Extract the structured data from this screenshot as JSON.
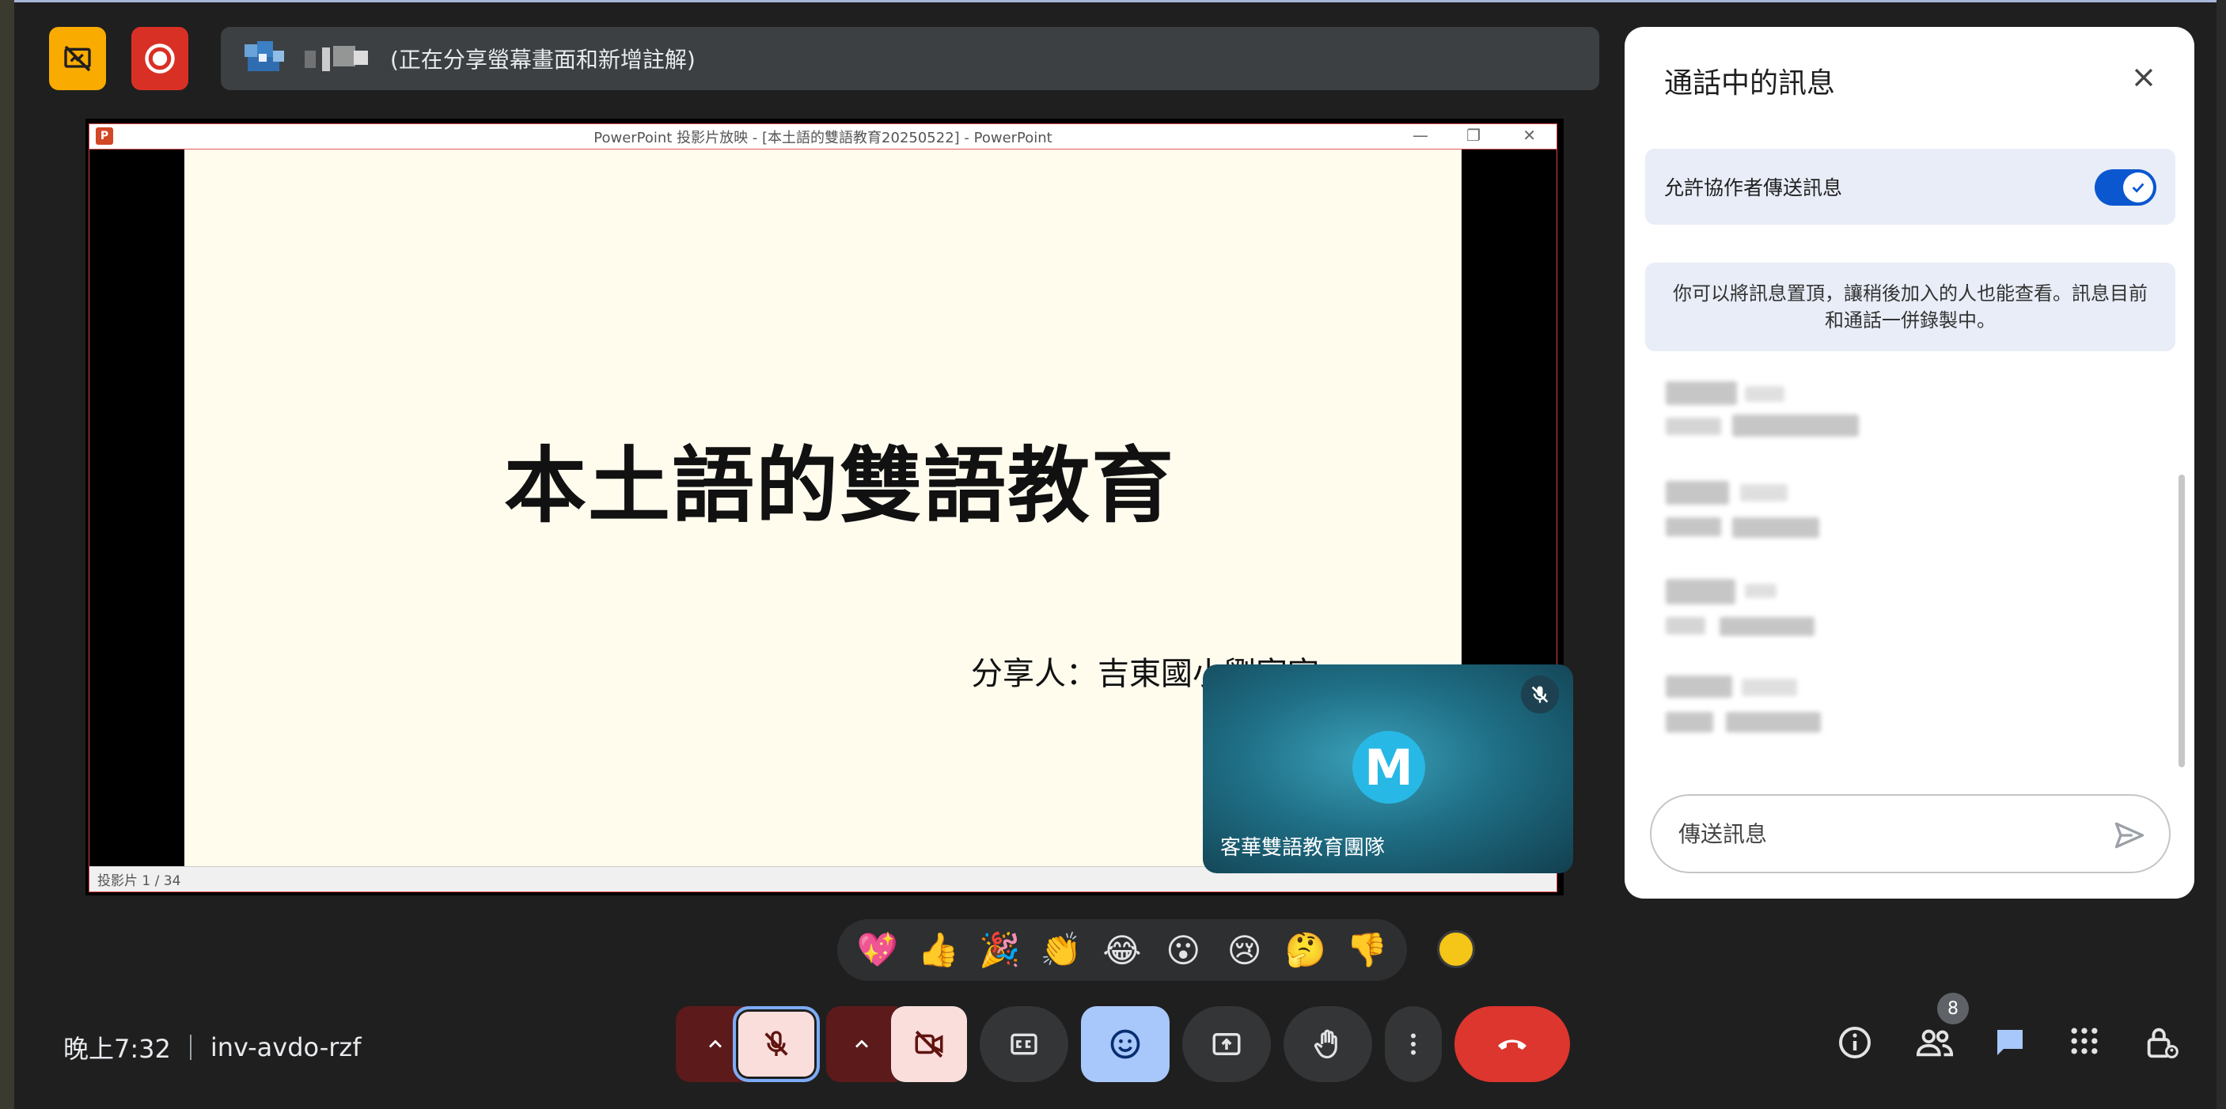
{
  "presenter": {
    "status_text": "(正在分享螢幕畫面和新增註解)"
  },
  "ppt": {
    "window_title": "PowerPoint 投影片放映 - [本土語的雙語教育20250522] - PowerPoint",
    "slide_title": "本土語的雙語教育",
    "slide_subtitle": "分享人：吉東國小劉家宏",
    "status_text": "投影片 1 / 34",
    "logo_letter": "P"
  },
  "tile": {
    "avatar_letter": "M",
    "name": "客華雙語教育團隊"
  },
  "chat": {
    "title": "通話中的訊息",
    "toggle_label": "允許協作者傳送訊息",
    "info_text": "你可以將訊息置頂，讓稍後加入的人也能查看。訊息目前和通話一併錄製中。",
    "compose_placeholder": "傳送訊息"
  },
  "reactions": [
    "💖",
    "👍",
    "🎉",
    "👏",
    "😂",
    "😮",
    "😢",
    "🤔",
    "👎"
  ],
  "bottom": {
    "time": "晚上7:32",
    "meeting_code": "inv-avdo-rzf",
    "participants_count": "8"
  },
  "colors": {
    "accent": "#0b57d0",
    "end_call": "#dc362e",
    "record": "#d93025",
    "captions_off": "#f9ab00",
    "reaction_active": "#a8c7fa"
  }
}
